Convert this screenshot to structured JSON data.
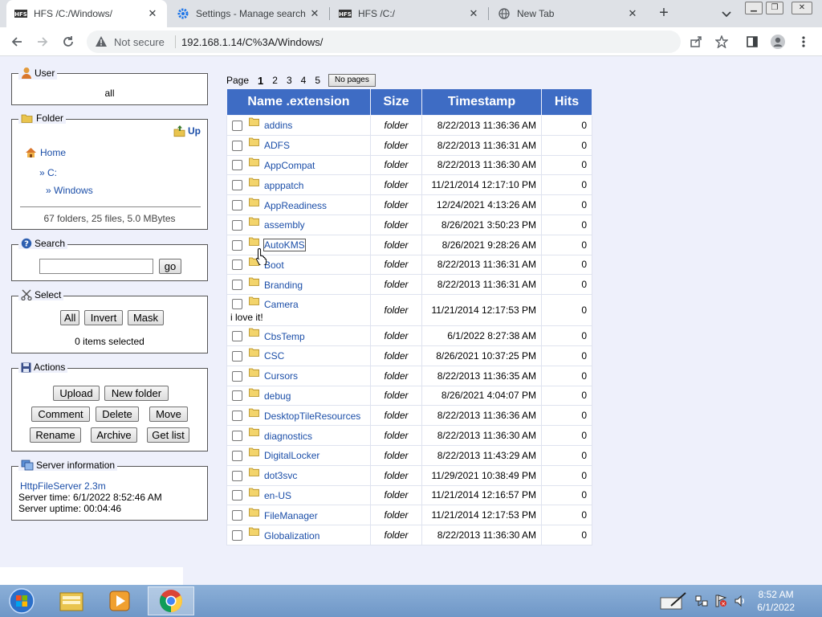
{
  "browser": {
    "tabs": [
      {
        "label": "HFS /C:/Windows/",
        "icon": "hfs-icon",
        "active": true
      },
      {
        "label": "Settings - Manage search",
        "icon": "gear-icon",
        "active": false
      },
      {
        "label": "HFS /C:/",
        "icon": "hfs-icon",
        "active": false
      },
      {
        "label": "New Tab",
        "icon": "globe-icon",
        "active": false
      }
    ],
    "security_label": "Not secure",
    "url": "192.168.1.14/C%3A/Windows/"
  },
  "sidebar": {
    "user": {
      "title": "User",
      "value": "all"
    },
    "folder": {
      "title": "Folder",
      "up_label": "Up",
      "home_label": "Home",
      "path": [
        "» C:",
        "» Windows"
      ],
      "summary": "67 folders, 25 files, 5.0 MBytes"
    },
    "search": {
      "title": "Search",
      "value": "",
      "go_label": "go"
    },
    "select": {
      "title": "Select",
      "all_label": "All",
      "invert_label": "Invert",
      "mask_label": "Mask",
      "status": "0 items selected"
    },
    "actions": {
      "title": "Actions",
      "upload": "Upload",
      "new_folder": "New folder",
      "comment": "Comment",
      "delete": "Delete",
      "move": "Move",
      "rename": "Rename",
      "archive": "Archive",
      "get_list": "Get list"
    },
    "server": {
      "title": "Server information",
      "version": "HttpFileServer 2.3m",
      "time": "Server time: 6/1/2022 8:52:46 AM",
      "uptime": "Server uptime: 00:04:46"
    }
  },
  "pager": {
    "label": "Page",
    "pages": [
      "1",
      "2",
      "3",
      "4",
      "5"
    ],
    "current": "1",
    "no_pages_label": "No pages"
  },
  "table": {
    "headers": [
      "Name .extension",
      "Size",
      "Timestamp",
      "Hits"
    ],
    "rows": [
      {
        "name": "addins",
        "size": "folder",
        "timestamp": "8/22/2013 11:36:36 AM",
        "hits": "0"
      },
      {
        "name": "ADFS",
        "size": "folder",
        "timestamp": "8/22/2013 11:36:31 AM",
        "hits": "0"
      },
      {
        "name": "AppCompat",
        "size": "folder",
        "timestamp": "8/22/2013 11:36:30 AM",
        "hits": "0"
      },
      {
        "name": "apppatch",
        "size": "folder",
        "timestamp": "11/21/2014 12:17:10 PM",
        "hits": "0"
      },
      {
        "name": "AppReadiness",
        "size": "folder",
        "timestamp": "12/24/2021 4:13:26 AM",
        "hits": "0"
      },
      {
        "name": "assembly",
        "size": "folder",
        "timestamp": "8/26/2021 3:50:23 PM",
        "hits": "0"
      },
      {
        "name": "AutoKMS",
        "size": "folder",
        "timestamp": "8/26/2021 9:28:26 AM",
        "hits": "0",
        "focused": true
      },
      {
        "name": "Boot",
        "size": "folder",
        "timestamp": "8/22/2013 11:36:31 AM",
        "hits": "0"
      },
      {
        "name": "Branding",
        "size": "folder",
        "timestamp": "8/22/2013 11:36:31 AM",
        "hits": "0"
      },
      {
        "name": "Camera",
        "size": "folder",
        "timestamp": "11/21/2014 12:17:53 PM",
        "hits": "0",
        "comment": "i love it!"
      },
      {
        "name": "CbsTemp",
        "size": "folder",
        "timestamp": "6/1/2022 8:27:38 AM",
        "hits": "0"
      },
      {
        "name": "CSC",
        "size": "folder",
        "timestamp": "8/26/2021 10:37:25 PM",
        "hits": "0"
      },
      {
        "name": "Cursors",
        "size": "folder",
        "timestamp": "8/22/2013 11:36:35 AM",
        "hits": "0"
      },
      {
        "name": "debug",
        "size": "folder",
        "timestamp": "8/26/2021 4:04:07 PM",
        "hits": "0"
      },
      {
        "name": "DesktopTileResources",
        "size": "folder",
        "timestamp": "8/22/2013 11:36:36 AM",
        "hits": "0"
      },
      {
        "name": "diagnostics",
        "size": "folder",
        "timestamp": "8/22/2013 11:36:30 AM",
        "hits": "0"
      },
      {
        "name": "DigitalLocker",
        "size": "folder",
        "timestamp": "8/22/2013 11:43:29 AM",
        "hits": "0"
      },
      {
        "name": "dot3svc",
        "size": "folder",
        "timestamp": "11/29/2021 10:38:49 PM",
        "hits": "0"
      },
      {
        "name": "en-US",
        "size": "folder",
        "timestamp": "11/21/2014 12:16:57 PM",
        "hits": "0"
      },
      {
        "name": "FileManager",
        "size": "folder",
        "timestamp": "11/21/2014 12:17:53 PM",
        "hits": "0"
      },
      {
        "name": "Globalization",
        "size": "folder",
        "timestamp": "8/22/2013 11:36:30 AM",
        "hits": "0"
      }
    ]
  },
  "taskbar": {
    "apps": [
      "start-orb",
      "file-explorer",
      "media-player",
      "chrome"
    ],
    "time": "8:52 AM",
    "date": "6/1/2022"
  }
}
